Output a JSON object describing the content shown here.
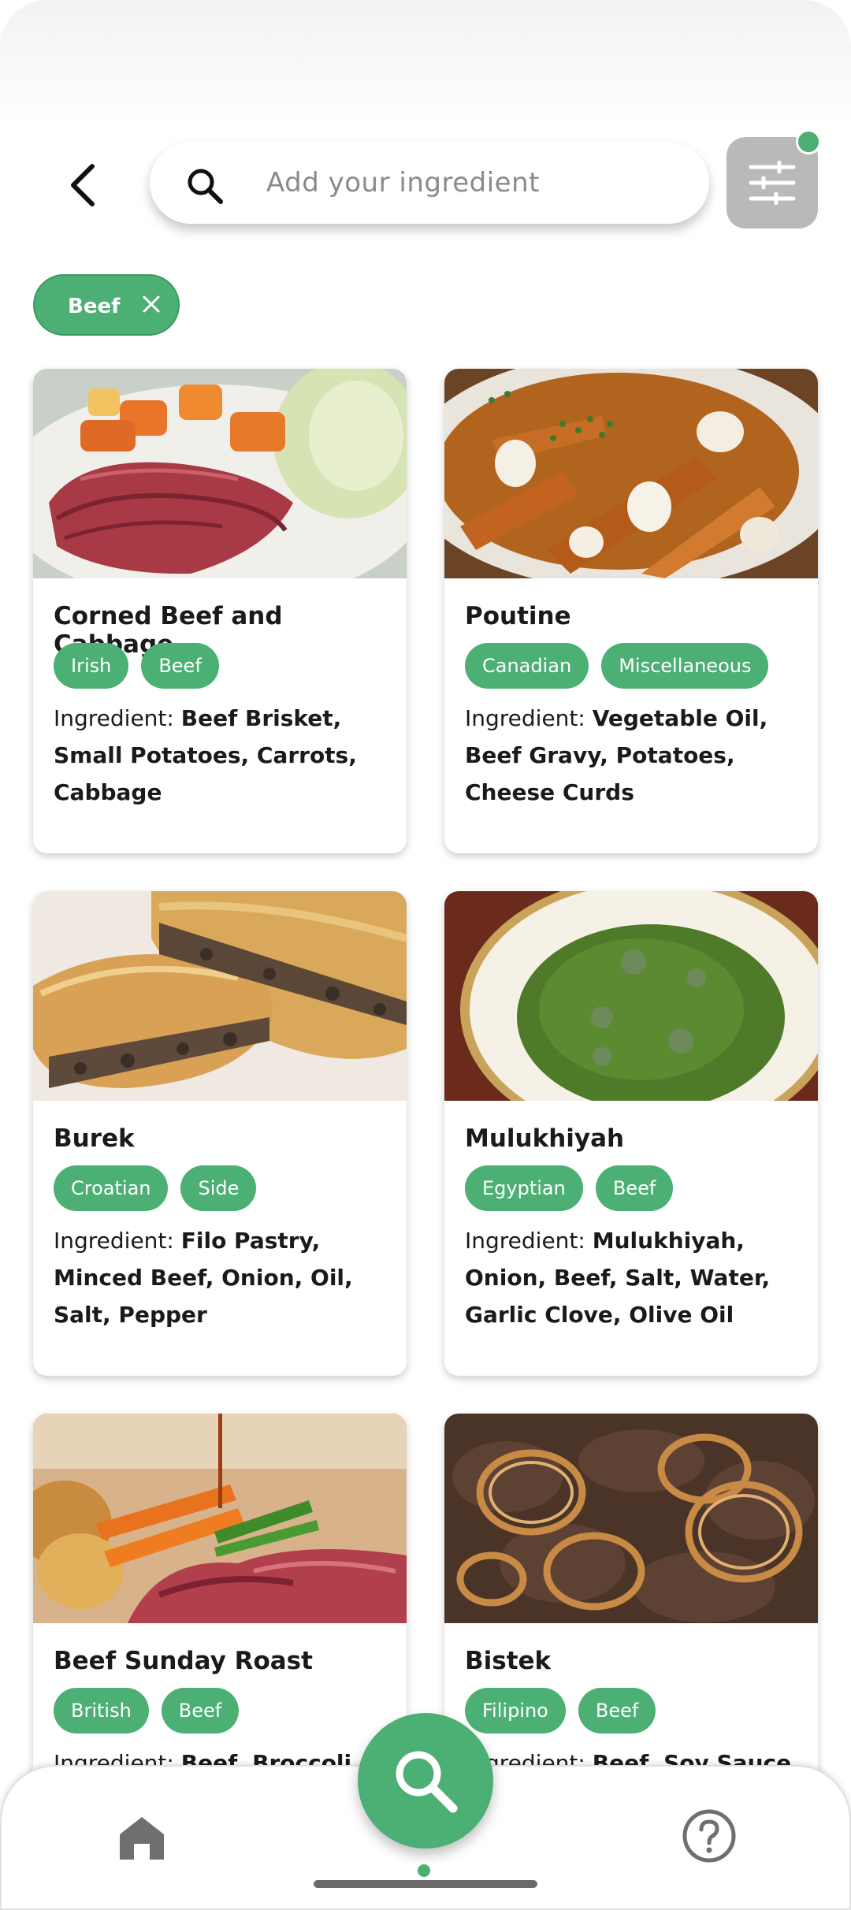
{
  "header": {
    "search_placeholder": "Add your ingredient",
    "filter_active": true
  },
  "active_filters": [
    {
      "label": "Beef"
    }
  ],
  "ingredient_label": "Ingredient: ",
  "recipes": [
    {
      "title": "Corned Beef and Cabbage",
      "tags": [
        "Irish",
        "Beef"
      ],
      "ingredients": "Beef Brisket, Small Potatoes, Carrots, Cabbage"
    },
    {
      "title": "Poutine",
      "tags": [
        "Canadian",
        "Miscellaneous"
      ],
      "ingredients": "Vegetable Oil, Beef Gravy, Potatoes, Cheese Curds"
    },
    {
      "title": "Burek",
      "tags": [
        "Croatian",
        "Side"
      ],
      "ingredients": "Filo Pastry, Minced Beef, Onion, Oil, Salt, Pepper"
    },
    {
      "title": "Mulukhiyah",
      "tags": [
        "Egyptian",
        "Beef"
      ],
      "ingredients": "Mulukhiyah, Onion, Beef, Salt, Water, Garlic Clove, Olive Oil"
    },
    {
      "title": "Beef Sunday Roast",
      "tags": [
        "British",
        "Beef"
      ],
      "ingredients": "Beef, Broccoli"
    },
    {
      "title": "Bistek",
      "tags": [
        "Filipino",
        "Beef"
      ],
      "ingredients": "Beef, Soy Sauce"
    }
  ],
  "nav": {
    "home_icon": "home-icon",
    "search_icon": "search-icon",
    "help_icon": "help-icon"
  },
  "colors": {
    "accent": "#4caf74",
    "filter_button": "#b9b9b9"
  }
}
